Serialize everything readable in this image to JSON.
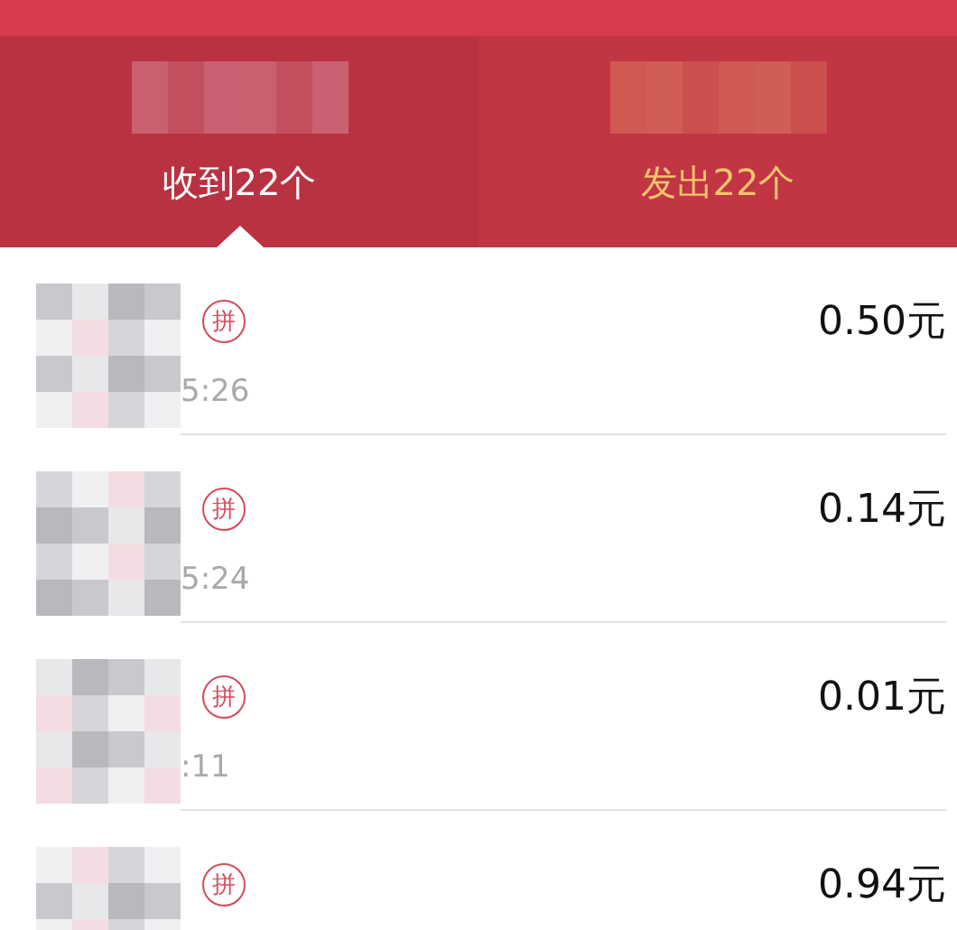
{
  "tabs": [
    {
      "label": "收到22个",
      "selected": true
    },
    {
      "label": "发出22个",
      "selected": false
    }
  ],
  "records": [
    {
      "badge": "拼",
      "time": "5:26",
      "amount": "0.50元"
    },
    {
      "badge": "拼",
      "time": "5:24",
      "amount": "0.14元"
    },
    {
      "badge": "拼",
      "time": ":11",
      "amount": "0.01元"
    },
    {
      "badge": "拼",
      "amount": "0.94元"
    }
  ]
}
